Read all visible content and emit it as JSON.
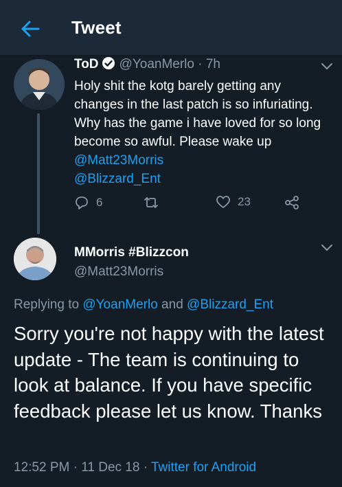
{
  "header": {
    "title": "Tweet",
    "back_icon": "arrow-left-icon",
    "accent": "#1da1f2"
  },
  "tweet1": {
    "display_name": "ToD",
    "handle": "@YoanMerlo",
    "time": "· 7h",
    "text_plain": "Holy shit the kotg barely getting any changes in the last patch is so infuriating. Why has  the game i have loved for so long become so awful. Please wake up ",
    "mention1": "@Matt23Morris",
    "mention2": "@Blizzard_Ent",
    "replies": "6",
    "retweets": "",
    "likes": "23",
    "verified": true
  },
  "tweet2": {
    "display_name": "MMorris #Blizzcon",
    "handle": "@Matt23Morris",
    "replying_prefix": "Replying to ",
    "replying_user1": "@YoanMerlo",
    "replying_and": " and ",
    "replying_user2": "@Blizzard_Ent",
    "text": "Sorry you're not happy with the latest update - The team is continuing to look at balance. If you have specific feedback please let us know. Thanks",
    "time": "12:52 PM",
    "dot1": " · ",
    "date": "11 Dec 18",
    "dot2": " · ",
    "client": "Twitter for Android"
  },
  "colors": {
    "background": "#141d26",
    "header": "#1c2938",
    "muted": "#8899a6",
    "link": "#1da1f2"
  }
}
